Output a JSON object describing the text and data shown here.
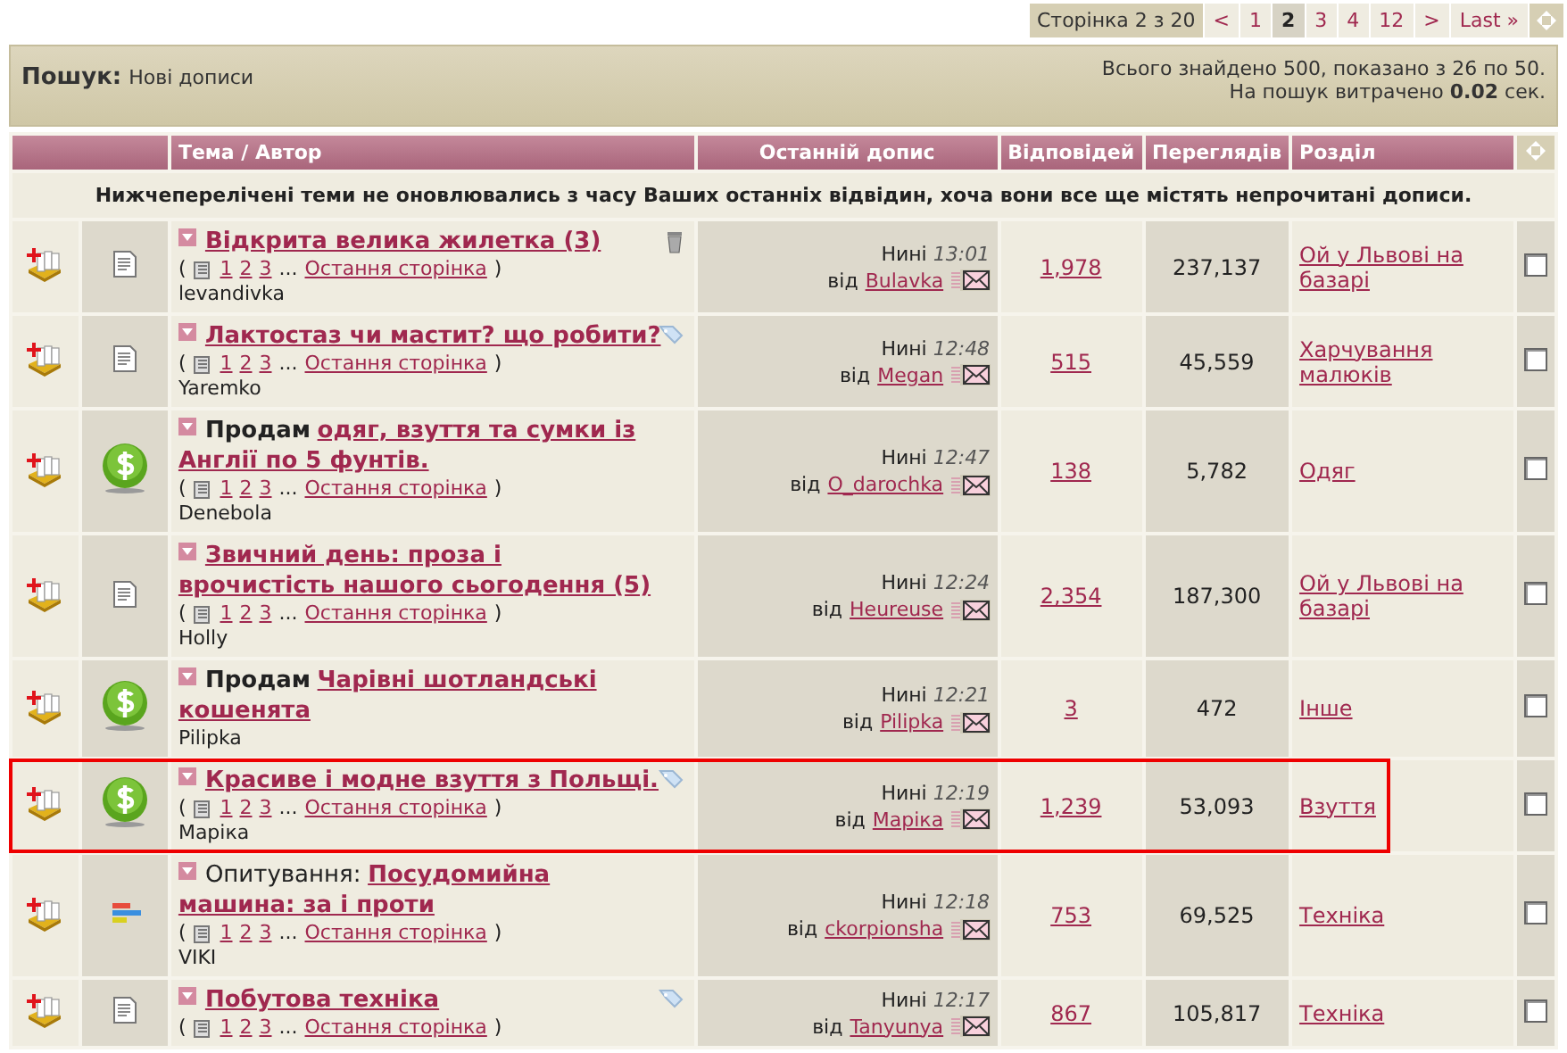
{
  "pagination": {
    "label": "Сторінка 2 з 20",
    "items": [
      {
        "text": "<",
        "selected": false
      },
      {
        "text": "1",
        "selected": false
      },
      {
        "text": "2",
        "selected": true
      },
      {
        "text": "3",
        "selected": false
      },
      {
        "text": "4",
        "selected": false
      },
      {
        "text": "12",
        "selected": false
      },
      {
        "text": ">",
        "selected": false
      },
      {
        "text": "Last »",
        "selected": false
      }
    ]
  },
  "search_header": {
    "title": "Пошук:",
    "subtitle": "Нові дописи",
    "summary": "Всього знайдено 500, показано з 26 по 50.",
    "timing": "На пошук витрачено **0.02** сек."
  },
  "columns": [
    "Тема / Автор",
    "Останній допис",
    "Відповідей",
    "Переглядів",
    "Розділ"
  ],
  "notice": "Нижчеперелічені теми не оновлювались з часу Ваших останніх відвідин, хоча вони все ще містять непрочитані дописи.",
  "rows": [
    {
      "kind": "post",
      "title": "Відкрита велика жилетка (3)",
      "trash": true,
      "tag": false,
      "open": "(",
      "close": ")",
      "pages": [
        "1",
        "2",
        "3"
      ],
      "ellipsis": "...",
      "last_page": "Остання сторінка",
      "author": "levandivka",
      "last_post": {
        "day": "Нині",
        "time": "13:01",
        "by": "від",
        "user": "Bulavka"
      },
      "replies": "1,978",
      "views": "237,137",
      "forum": "Ой у Львові на базарі",
      "checked": false,
      "highlighted": false
    },
    {
      "kind": "post",
      "title": "Лактостаз чи мастит? що робити?",
      "trash": false,
      "tag": true,
      "open": "(",
      "close": ")",
      "pages": [
        "1",
        "2",
        "3"
      ],
      "ellipsis": "...",
      "last_page": "Остання сторінка",
      "author": "Yaremko",
      "last_post": {
        "day": "Нині",
        "time": "12:48",
        "by": "від",
        "user": "Megan"
      },
      "replies": "515",
      "views": "45,559",
      "forum": "Харчування малюків",
      "checked": false,
      "highlighted": false
    },
    {
      "kind": "sale",
      "prefix": "Продам",
      "title": "одяг, взуття та сумки із Англії по 5 фунтів.",
      "trash": false,
      "tag": false,
      "open": "(",
      "close": ")",
      "pages": [
        "1",
        "2",
        "3"
      ],
      "ellipsis": "...",
      "last_page": "Остання сторінка",
      "author": "Denebola",
      "last_post": {
        "day": "Нині",
        "time": "12:47",
        "by": "від",
        "user": "O_darochka"
      },
      "replies": "138",
      "views": "5,782",
      "forum": "Одяг",
      "checked": false,
      "highlighted": false
    },
    {
      "kind": "post",
      "title": "Звичний день: проза і врочистість нашого сьогодення (5)",
      "trash": false,
      "tag": false,
      "open": "(",
      "close": ")",
      "pages": [
        "1",
        "2",
        "3"
      ],
      "ellipsis": "...",
      "last_page": "Остання сторінка",
      "author": "Holly",
      "last_post": {
        "day": "Нині",
        "time": "12:24",
        "by": "від",
        "user": "Heureuse"
      },
      "replies": "2,354",
      "views": "187,300",
      "forum": "Ой у Львові на базарі",
      "checked": false,
      "highlighted": false
    },
    {
      "kind": "sale",
      "prefix": "Продам",
      "title": "Чарівні шотландські кошенята",
      "trash": false,
      "tag": false,
      "author": "Pilipka",
      "last_post": {
        "day": "Нині",
        "time": "12:21",
        "by": "від",
        "user": "Pilipka"
      },
      "replies": "3",
      "views": "472",
      "forum": "Інше",
      "checked": false,
      "highlighted": false
    },
    {
      "kind": "sale",
      "title": "Красиве і модне взуття з Польщі.",
      "trash": false,
      "tag": true,
      "open": "(",
      "close": ")",
      "pages": [
        "1",
        "2",
        "3"
      ],
      "ellipsis": "...",
      "last_page": "Остання сторінка",
      "author": "Маріка",
      "last_post": {
        "day": "Нині",
        "time": "12:19",
        "by": "від",
        "user": "Маріка"
      },
      "replies": "1,239",
      "views": "53,093",
      "forum": "Взуття",
      "checked": false,
      "highlighted": true
    },
    {
      "kind": "poll",
      "prefix": "Опитування:",
      "title": "Посудомийна машина: за і проти",
      "trash": false,
      "tag": false,
      "open": "(",
      "close": ")",
      "pages": [
        "1",
        "2",
        "3"
      ],
      "ellipsis": "...",
      "last_page": "Остання сторінка",
      "author": "VIKI",
      "last_post": {
        "day": "Нині",
        "time": "12:18",
        "by": "від",
        "user": "ckorpionsha"
      },
      "replies": "753",
      "views": "69,525",
      "forum": "Техніка",
      "checked": false,
      "highlighted": false
    },
    {
      "kind": "post",
      "title": "Побутова техніка",
      "trash": false,
      "tag": true,
      "open": "(",
      "close": ")",
      "pages": [
        "1",
        "2",
        "3"
      ],
      "ellipsis": "...",
      "last_page": "Остання сторінка",
      "last_post": {
        "day": "Нині",
        "time": "12:17",
        "by": "від",
        "user": "Tanyunya"
      },
      "replies": "867",
      "views": "105,817",
      "forum": "Техніка",
      "checked": false,
      "highlighted": false
    }
  ]
}
